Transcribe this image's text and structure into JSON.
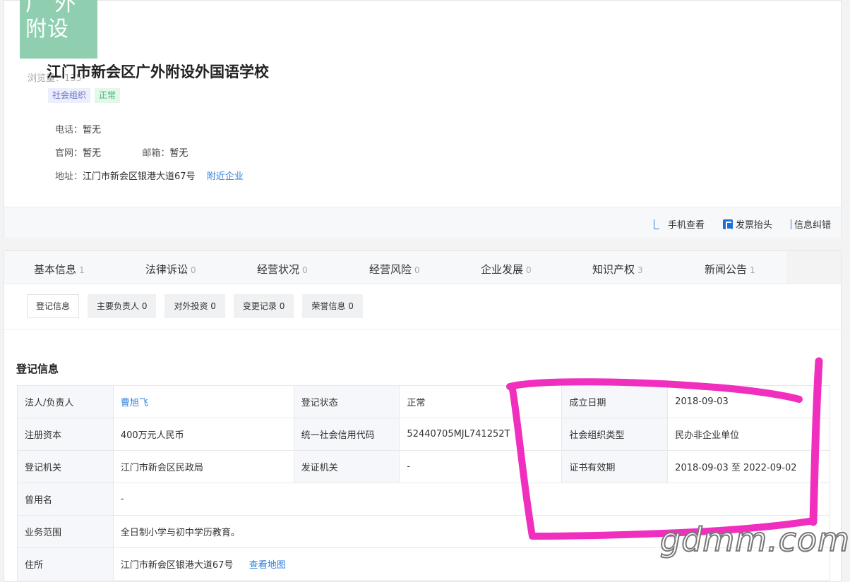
{
  "header": {
    "logo_line1": "广 外",
    "logo_line2": "附设",
    "views": "浏览量：135",
    "company_name": "江门市新会区广外附设外国语学校",
    "tags": [
      "社会组织",
      "正常"
    ],
    "phone_label": "电话：",
    "phone_value": "暂无",
    "website_label": "官网：",
    "website_value": "暂无",
    "email_label": "邮箱：",
    "email_value": "暂无",
    "address_label": "地址：",
    "address_value": "江门市新会区银港大道67号",
    "nearby_link": "附近企业"
  },
  "actions": {
    "mobile": "手机查看",
    "invoice": "发票抬头",
    "correct": "信息纠错"
  },
  "tabs": [
    {
      "label": "基本信息",
      "count": "1"
    },
    {
      "label": "法律诉讼",
      "count": "0"
    },
    {
      "label": "经营状况",
      "count": "0"
    },
    {
      "label": "经营风险",
      "count": "0"
    },
    {
      "label": "企业发展",
      "count": "0"
    },
    {
      "label": "知识产权",
      "count": "3"
    },
    {
      "label": "新闻公告",
      "count": "1"
    }
  ],
  "subtabs": [
    "登记信息",
    "主要负责人 0",
    "对外投资 0",
    "变更记录 0",
    "荣誉信息 0"
  ],
  "section_title": "登记信息",
  "registration": {
    "legal_person_label": "法人/负责人",
    "legal_person": "曹旭飞",
    "status_label": "登记状态",
    "status": "正常",
    "founded_label": "成立日期",
    "founded": "2018-09-03",
    "capital_label": "注册资本",
    "capital": "400万元人民币",
    "credit_code_label": "统一社会信用代码",
    "credit_code": "52440705MJL741252T",
    "org_type_label": "社会组织类型",
    "org_type": "民办非企业单位",
    "authority_label": "登记机关",
    "authority": "江门市新会区民政局",
    "issuer_label": "发证机关",
    "issuer": "-",
    "validity_label": "证书有效期",
    "validity": "2018-09-03 至 2022-09-02",
    "former_name_label": "曾用名",
    "former_name": "-",
    "scope_label": "业务范围",
    "scope": "全日制小学与初中学历教育。",
    "residence_label": "住所",
    "residence": "江门市新会区银港大道67号",
    "map_link": "查看地图"
  },
  "watermark": "gdmm.com",
  "colors": {
    "link": "#2d7fdc",
    "marker": "#f02fbf",
    "logo_bg": "#8fcfb0"
  }
}
